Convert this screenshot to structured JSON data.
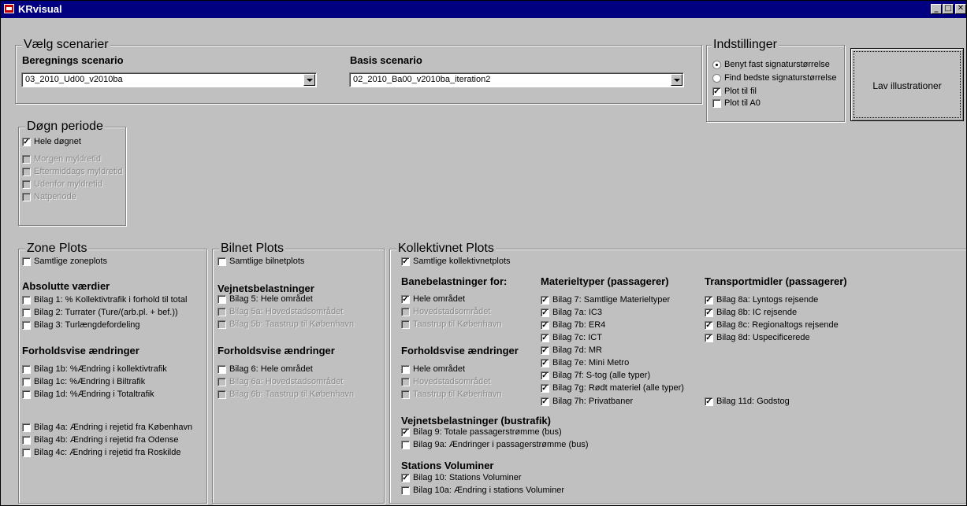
{
  "window": {
    "title": "KRvisual",
    "controls": [
      "_",
      "□",
      "✕"
    ]
  },
  "scenarios": {
    "legend": "Vælg scenarier",
    "beregning_label": "Beregnings scenario",
    "beregning_value": "03_2010_Ud00_v2010ba",
    "basis_label": "Basis scenario",
    "basis_value": "02_2010_Ba00_v2010ba_iteration2"
  },
  "indstillinger": {
    "legend": "Indstillinger",
    "radio1": "Benyt fast signaturstørrelse",
    "radio2": "Find bedste signaturstørrelse",
    "cb1": "Plot til fil",
    "cb2": "Plot til A0"
  },
  "lav_button": "Lav illustrationer",
  "dogn": {
    "legend": "Døgn periode",
    "items": [
      "Hele døgnet",
      "Morgen myldretid",
      "Eftermiddags myldretid",
      "Udenfor myldretid",
      "Natperiode"
    ]
  },
  "zone": {
    "legend": "Zone Plots",
    "samtlige": "Samtlige zoneplots",
    "abs_heading": "Absolutte værdier",
    "abs_items": [
      "Bilag 1: % Kollektivtrafik i forhold til total",
      "Bilag 2: Turrater (Ture/(arb.pl. + bef.))",
      "Bilag 3: Turlængdefordeling"
    ],
    "rel_heading": "Forholdsvise ændringer",
    "rel_items": [
      "Bilag 1b: %Ændring i kollektivtrafik",
      "Bilag 1c: %Ændring i Biltrafik",
      "Bilag 1d: %Ændring i Totaltrafik"
    ],
    "rej_items": [
      "Bilag 4a: Ændring i rejetid fra København",
      "Bilag 4b: Ændring i rejetid fra Odense",
      "Bilag 4c: Ændring i rejetid fra Roskilde"
    ]
  },
  "bilnet": {
    "legend": "Bilnet Plots",
    "samtlige": "Samtlige bilnetplots",
    "vej_heading": "Vejnetsbelastninger",
    "vej_items": [
      "Bilag 5: Hele området",
      "Bilag 5a: Hovedstadsområdet",
      "Bilag 5b: Taastrup til København"
    ],
    "rel_heading": "Forholdsvise ændringer",
    "rel_items": [
      "Bilag 6: Hele området",
      "Bilag 6a: Hovedstadsområdet",
      "Bilag 6b: Taastrup til København"
    ]
  },
  "kollektiv": {
    "legend": "Kollektivnet Plots",
    "samtlige": "Samtlige kollektivnetplots",
    "bane_heading": "Banebelastninger for:",
    "bane_items": [
      "Hele området",
      "Hovedstadsområdet",
      "Taastrup til København"
    ],
    "rel_heading": "Forholdsvise ændringer",
    "rel_items": [
      "Hele området",
      "Hovedstadsområdet",
      "Taastrup til København"
    ],
    "mat_heading": "Materieltyper (passagerer)",
    "mat_items": [
      "Bilag 7: Samtlige Materieltyper",
      "Bilag 7a: IC3",
      "Bilag 7b: ER4",
      "Bilag 7c: ICT",
      "Bilag 7d: MR",
      "Bilag 7e: Mini Metro",
      "Bilag 7f: S-tog (alle typer)",
      "Bilag 7g: Rødt materiel (alle typer)",
      "Bilag 7h: Privatbaner"
    ],
    "trans_heading": "Transportmidler (passagerer)",
    "trans_items": [
      "Bilag 8a: Lyntogs rejsende",
      "Bilag 8b: IC rejsende",
      "Bilag 8c: Regionaltogs rejsende",
      "Bilag 8d: Uspecificerede"
    ],
    "godstog": "Bilag 11d: Godstog",
    "bus_heading": "Vejnetsbelastninger (bustrafik)",
    "bus_items": [
      "Bilag 9: Totale passagerstrømme (bus)",
      "Bilag 9a: Ændringer i passagerstrømme (bus)"
    ],
    "stat_heading": "Stations Voluminer",
    "stat_items": [
      "Bilag 10: Stations Voluminer",
      "Bilag 10a: Ændring i stations Voluminer"
    ]
  }
}
